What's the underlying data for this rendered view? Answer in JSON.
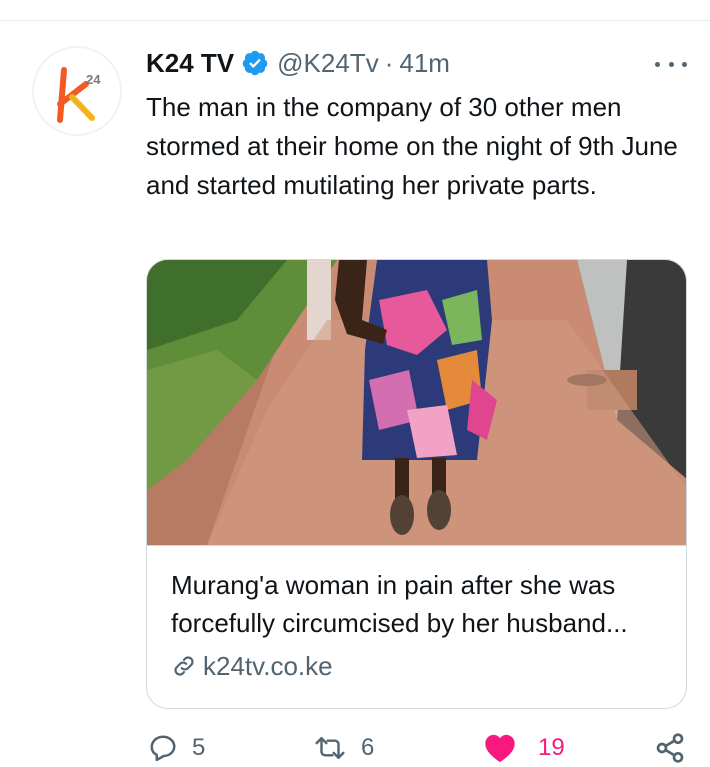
{
  "tweet": {
    "author": {
      "display_name": "K24 TV",
      "handle": "@K24Tv",
      "verified": true,
      "avatar_icon": "k24-logo"
    },
    "separator": "·",
    "timestamp": "41m",
    "text": "The man in the company of 30 other men stormed at their home on the night of 9th June and started mutilating her private parts.",
    "card": {
      "image_icon": "photo-of-woman-in-floral-dress",
      "title": "Murang'a woman in pain after she was forcefully circumcised by her husband...",
      "domain": "k24tv.co.ke"
    },
    "actions": {
      "replies": "5",
      "retweets": "6",
      "likes": "19",
      "liked": true
    }
  },
  "colors": {
    "verified": "#1d9bf0",
    "like": "#f91880",
    "secondary_text": "#536471",
    "border": "#cfd9de"
  }
}
